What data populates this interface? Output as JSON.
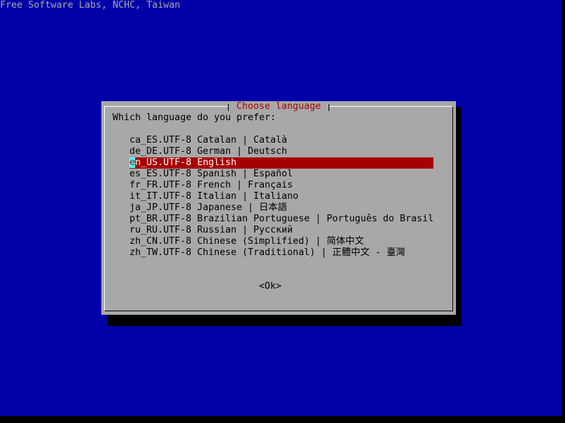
{
  "backtitle": "Free Software Labs, NCHC, Taiwan",
  "dialog": {
    "title": "Choose language",
    "prompt": "Which language do you prefer:",
    "items": [
      {
        "code": "ca_ES.UTF-8",
        "desc": "Catalan | Català"
      },
      {
        "code": "de_DE.UTF-8",
        "desc": "German | Deutsch"
      },
      {
        "code": "en_US.UTF-8",
        "desc": "English"
      },
      {
        "code": "es_ES.UTF-8",
        "desc": "Spanish | Español"
      },
      {
        "code": "fr_FR.UTF-8",
        "desc": "French | Français"
      },
      {
        "code": "it_IT.UTF-8",
        "desc": "Italian | Italiano"
      },
      {
        "code": "ja_JP.UTF-8",
        "desc": "Japanese | 日本語"
      },
      {
        "code": "pt_BR.UTF-8",
        "desc": "Brazilian Portuguese | Português do Brasil"
      },
      {
        "code": "ru_RU.UTF-8",
        "desc": "Russian | Русский"
      },
      {
        "code": "zh_CN.UTF-8",
        "desc": "Chinese (Simplified) | 简体中文"
      },
      {
        "code": "zh_TW.UTF-8",
        "desc": "Chinese (Traditional) | 正體中文 - 臺灣"
      }
    ],
    "selected_index": 2,
    "ok_label": "<Ok>"
  },
  "colors": {
    "screen_bg": "#0000a8",
    "dialog_bg": "#a8a8a8",
    "title_fg": "#a80000",
    "selection_bg": "#a80000",
    "cursor_bg": "#54ffff"
  }
}
